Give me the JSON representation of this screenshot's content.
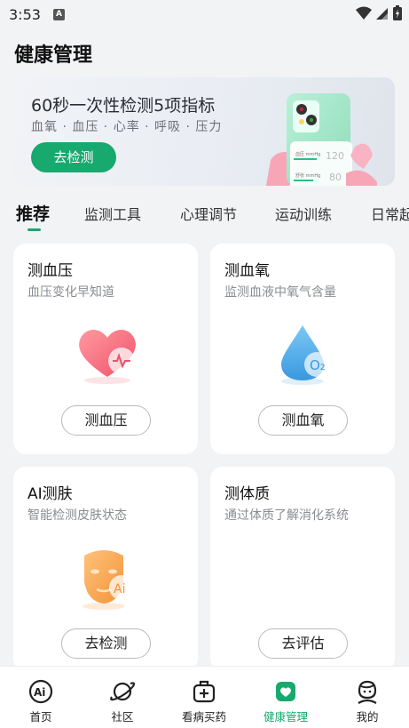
{
  "status_bar": {
    "time": "3:53",
    "notification_glyph": "A"
  },
  "page_title": "健康管理",
  "banner": {
    "title": "60秒一次性检测5项指标",
    "subtitle": "血氧 · 血压 · 心率 · 呼吸 · 压力",
    "button": "去检测",
    "phone_readouts": [
      "120",
      "80"
    ]
  },
  "tabs": [
    "推荐",
    "监测工具",
    "心理调节",
    "运动训练",
    "日常起"
  ],
  "active_tab": "推荐",
  "cards": [
    {
      "title": "测血压",
      "desc": "血压变化早知道",
      "button": "测血压",
      "icon": "heart-icon"
    },
    {
      "title": "测血氧",
      "desc": "监测血液中氧气含量",
      "button": "测血氧",
      "icon": "water-drop-icon",
      "icon_text": "O₂"
    },
    {
      "title": "AI测肤",
      "desc": "智能检测皮肤状态",
      "button": "去检测",
      "icon": "face-mask-icon",
      "icon_text": "Ai"
    },
    {
      "title": "测体质",
      "desc": "通过体质了解消化系统",
      "button": "去评估",
      "icon": "body-constitution-icon"
    }
  ],
  "bottom_nav": [
    {
      "label": "首页",
      "icon": "ai-home-icon"
    },
    {
      "label": "社区",
      "icon": "planet-icon"
    },
    {
      "label": "看病买药",
      "icon": "medical-kit-icon"
    },
    {
      "label": "健康管理",
      "icon": "health-heart-icon",
      "active": true
    },
    {
      "label": "我的",
      "icon": "profile-face-icon"
    }
  ],
  "colors": {
    "accent": "#17a96e",
    "page_bg": "#f2f3f5"
  }
}
